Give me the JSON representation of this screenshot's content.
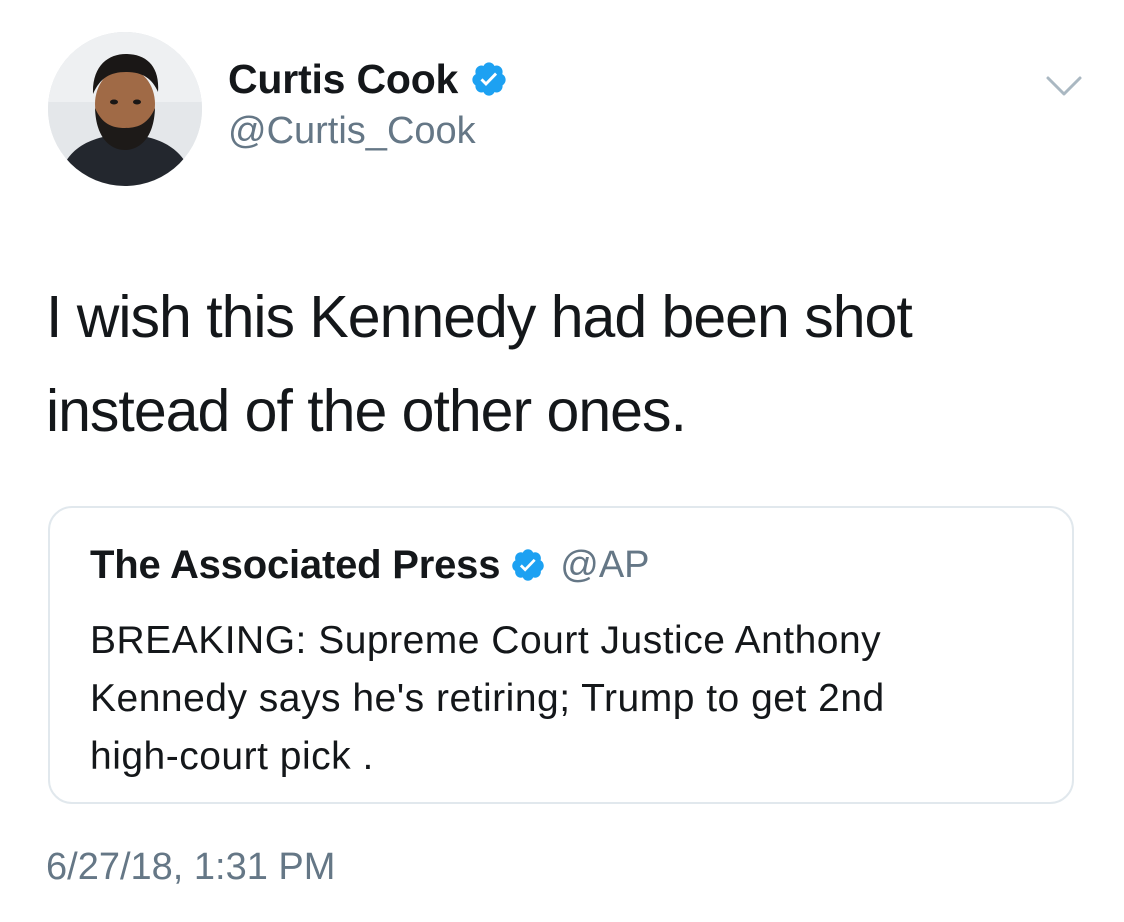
{
  "author": {
    "display_name": "Curtis Cook",
    "handle": "@Curtis_Cook",
    "verified": true
  },
  "tweet": {
    "text_lines": [
      "I wish this Kennedy had been shot",
      "instead of the other ones."
    ],
    "timestamp": "6/27/18, 1:31 PM"
  },
  "quoted_tweet": {
    "display_name": "The Associated Press",
    "handle": "@AP",
    "verified": true,
    "text_lines": [
      "BREAKING: Supreme Court Justice Anthony",
      "Kennedy says he's retiring; Trump to get 2nd",
      "high-court pick ."
    ]
  },
  "icons": {
    "verified": "verified-badge-icon",
    "menu": "chevron-down-icon"
  },
  "colors": {
    "verified_blue": "#1da1f2",
    "secondary_text": "#657786",
    "primary_text": "#14171a",
    "card_border": "#e1e8ed"
  }
}
